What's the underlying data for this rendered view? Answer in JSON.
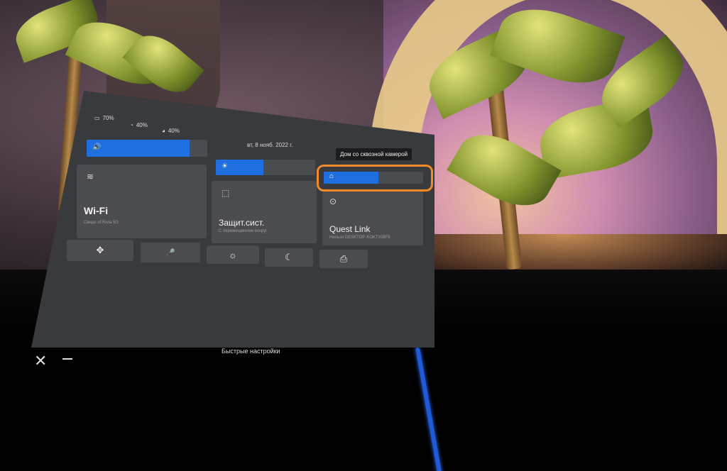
{
  "status": {
    "headset_battery": "70%",
    "left_controller_battery": "40%",
    "right_controller_battery": "40%"
  },
  "date": "вт, 8 нояб. 2022 г.",
  "tooltip": "Дом со сквозной камерой",
  "sliders": {
    "volume": {
      "icon": "🔊",
      "level": 0.85
    },
    "brightness": {
      "icon": "☀",
      "level": 0.48
    },
    "passthrough_home": {
      "icon": "⌂",
      "level": 0.55
    }
  },
  "tiles": {
    "wifi": {
      "icon": "≋",
      "title": "Wi-Fi",
      "subtitle": "Свиде of Rivia 5G"
    },
    "guardian": {
      "icon": "⬚",
      "title": "Защит.сист.",
      "subtitle": "С перемещением вокруг"
    },
    "quest_link": {
      "icon": "⊙",
      "title": "Quest Link",
      "subtitle": "Нельзя DESKTOP-KOKTXIBF9"
    }
  },
  "buttons": {
    "recenter": "✥",
    "mic": "🎤",
    "night_display": "☼",
    "do_not_disturb": "☾",
    "cast": "⎙"
  },
  "footer": {
    "title": "Быстрые настройки",
    "close": "✕"
  }
}
